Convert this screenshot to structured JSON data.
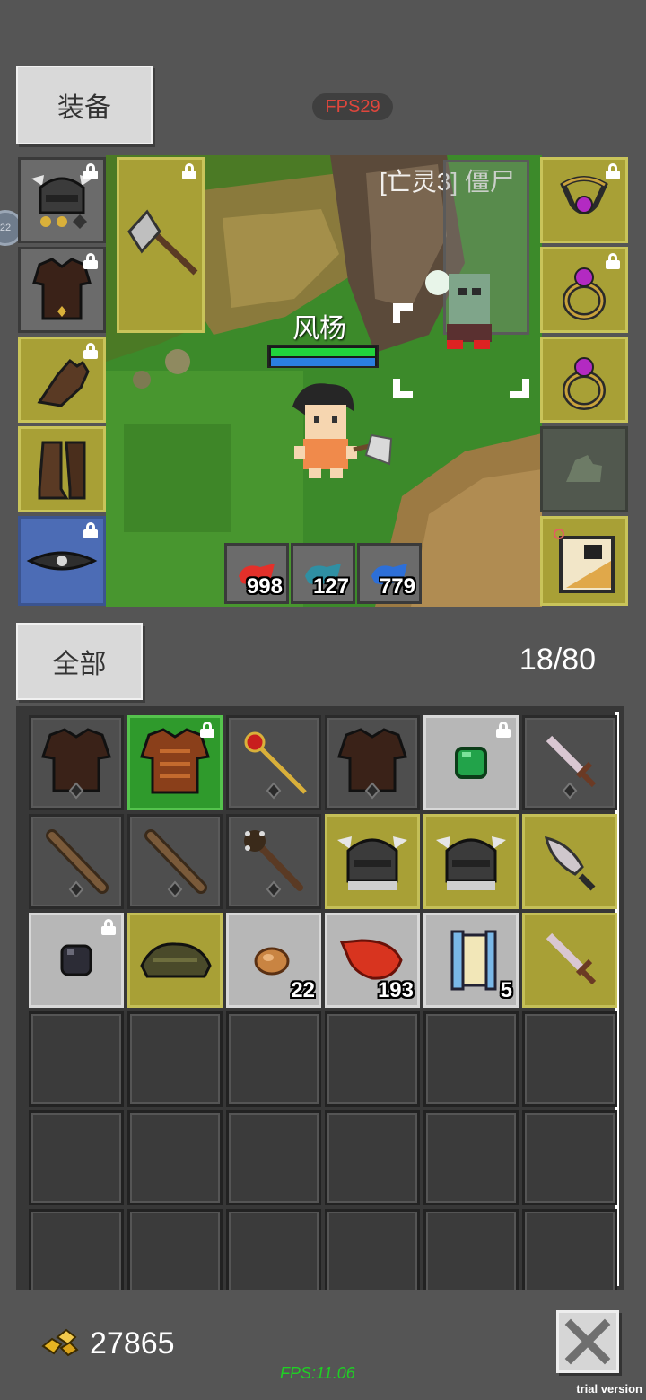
{
  "tabs": {
    "equipment": "装备",
    "all": "全部"
  },
  "fps_top": "FPS29",
  "scene": {
    "player_name": "风杨",
    "enemy_label": "[亡灵3] 僵尸",
    "player_hp_fraction": 1.0,
    "player_mp_fraction": 1.0,
    "potions": [
      {
        "icon": "red-potion-icon",
        "count": "998"
      },
      {
        "icon": "teal-potion-icon",
        "count": "127"
      },
      {
        "icon": "blue-potion-icon",
        "count": "779"
      }
    ]
  },
  "equipment": {
    "left": [
      {
        "icon": "horned-helmet-icon",
        "locked": true
      },
      {
        "icon": "leather-armor-icon",
        "locked": true
      },
      {
        "icon": "glove-icon",
        "locked": true
      },
      {
        "icon": "boots-icon",
        "locked": false
      },
      {
        "icon": "belt-icon",
        "locked": true
      }
    ],
    "weapon": {
      "icon": "axe-icon",
      "locked": true
    },
    "right": [
      {
        "icon": "amulet-icon",
        "locked": true
      },
      {
        "icon": "ring-icon",
        "locked": true
      },
      {
        "icon": "ring-icon",
        "locked": false
      },
      {
        "icon": "mount-icon",
        "locked": false
      },
      {
        "icon": "pet-icon",
        "locked": false
      }
    ]
  },
  "inventory": {
    "count": "18/80",
    "items": [
      {
        "icon": "leather-armor-icon",
        "style": "dark",
        "count": "",
        "locked": false
      },
      {
        "icon": "bronze-armor-icon",
        "style": "green",
        "count": "",
        "locked": true
      },
      {
        "icon": "ruby-staff-icon",
        "style": "dark",
        "count": "",
        "locked": false
      },
      {
        "icon": "leather-armor-icon",
        "style": "dark",
        "count": "",
        "locked": false
      },
      {
        "icon": "emerald-gem-icon",
        "style": "light",
        "count": "",
        "locked": true
      },
      {
        "icon": "short-sword-icon",
        "style": "dark",
        "count": "",
        "locked": false
      },
      {
        "icon": "wooden-club-icon",
        "style": "dark",
        "count": "",
        "locked": false
      },
      {
        "icon": "wooden-club-icon",
        "style": "dark",
        "count": "",
        "locked": false
      },
      {
        "icon": "spiked-club-icon",
        "style": "dark",
        "count": "",
        "locked": false
      },
      {
        "icon": "horned-helmet-icon",
        "style": "olive",
        "count": "",
        "locked": false
      },
      {
        "icon": "horned-helmet-icon",
        "style": "olive",
        "count": "",
        "locked": false
      },
      {
        "icon": "dagger-icon",
        "style": "olive",
        "count": "",
        "locked": false
      },
      {
        "icon": "dark-ore-icon",
        "style": "light",
        "count": "",
        "locked": true
      },
      {
        "icon": "turtle-shell-icon",
        "style": "olive",
        "count": "",
        "locked": false
      },
      {
        "icon": "bread-icon",
        "style": "light",
        "count": "22",
        "locked": false
      },
      {
        "icon": "red-feather-icon",
        "style": "light",
        "count": "193",
        "locked": false
      },
      {
        "icon": "scroll-icon",
        "style": "light",
        "count": "5",
        "locked": false
      },
      {
        "icon": "short-sword-icon",
        "style": "olive",
        "count": "",
        "locked": false
      }
    ],
    "empty_rows_visible": 3
  },
  "gold": {
    "icon": "gold-nuggets-icon",
    "amount": "27865"
  },
  "close": {
    "icon": "close-icon"
  },
  "fps_bottom": "FPS:11.06",
  "watermark": "trial version",
  "colors": {
    "panel": "#555555",
    "olive_slot": "#a8a036",
    "green_slot": "#2f9a2c",
    "blue_slot": "#4c6cb5",
    "hp": "#21d33c",
    "mp": "#2b7fe0"
  }
}
